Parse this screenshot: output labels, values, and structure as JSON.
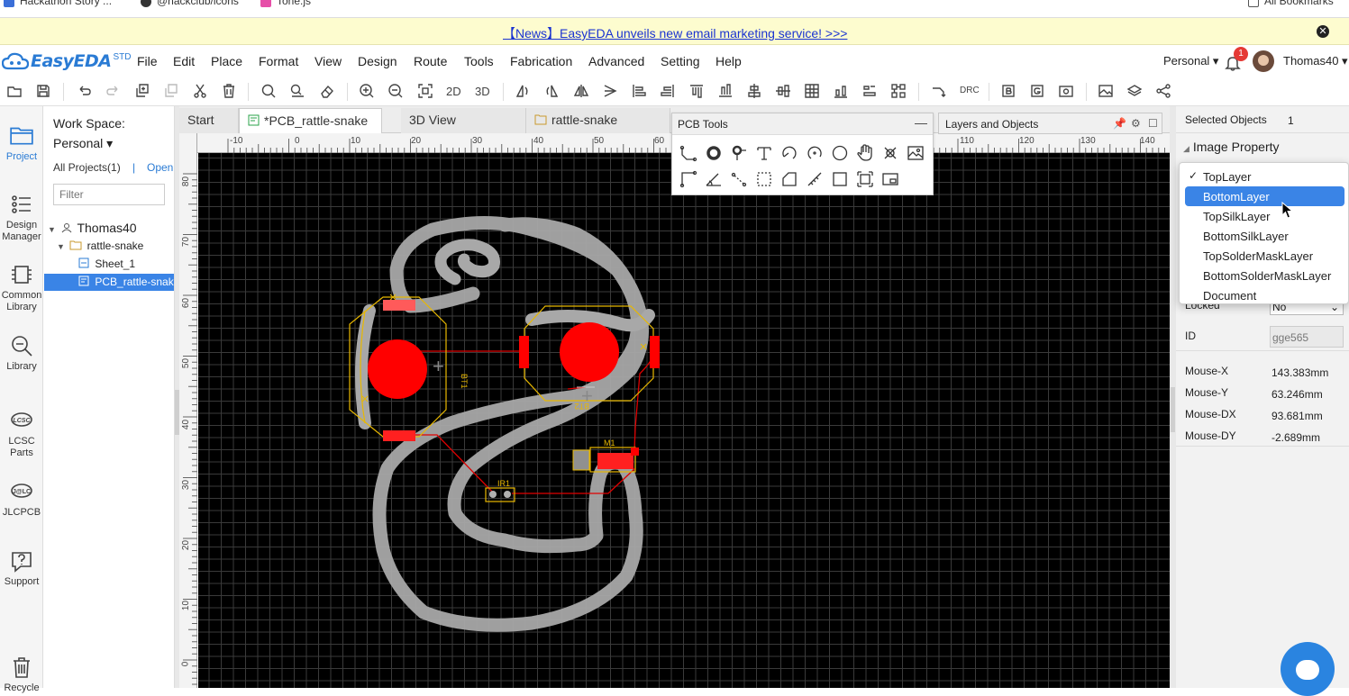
{
  "bookmarks": {
    "items": [
      "Hackathon Story ...",
      "@hackclub/icons",
      "Tone.js"
    ],
    "all": "All Bookmarks"
  },
  "news": {
    "text": "【News】EasyEDA unveils new email marketing service! >>>"
  },
  "logo": {
    "name": "EasyEDA",
    "edition": "STD"
  },
  "menu": [
    "File",
    "Edit",
    "Place",
    "Format",
    "View",
    "Design",
    "Route",
    "Tools",
    "Fabrication",
    "Advanced",
    "Setting",
    "Help"
  ],
  "user": {
    "workspace": "Personal",
    "notifications": "1",
    "name": "Thomas40"
  },
  "toolbar": {
    "view_2d": "2D",
    "view_3d": "3D",
    "drc": "DRC"
  },
  "leftnav": [
    {
      "label": "Project",
      "icon": "folder-icon"
    },
    {
      "label": "Design Manager",
      "icon": "list-icon"
    },
    {
      "label": "Common Library",
      "icon": "chip-icon"
    },
    {
      "label": "Library",
      "icon": "search-icon"
    },
    {
      "label": "LCSC Parts",
      "icon": "lcsc-icon"
    },
    {
      "label": "JLCPCB",
      "icon": "jlc-icon"
    },
    {
      "label": "Support",
      "icon": "help-icon"
    },
    {
      "label": "Recycle",
      "icon": "trash-icon"
    }
  ],
  "project_panel": {
    "workspace_label": "Work Space:",
    "workspace_value": "Personal",
    "all_projects": "All Projects(1)",
    "separator": "|",
    "open": "Open",
    "filter_placeholder": "Filter",
    "tree": {
      "user": "Thomas40",
      "project": "rattle-snake",
      "sheet": "Sheet_1",
      "pcb": "PCB_rattle-snake"
    }
  },
  "tabs": [
    "Start",
    "*PCB_rattle-snake",
    "3D View",
    "rattle-snake"
  ],
  "rulers": {
    "h": [
      "-10",
      "0",
      "10",
      "20",
      "30",
      "40",
      "50",
      "60",
      "110",
      "120",
      "130",
      "140"
    ],
    "v": [
      "80",
      "70",
      "60",
      "50",
      "40",
      "30",
      "20",
      "10",
      "0"
    ]
  },
  "pcb_labels": {
    "bt1": "BT1",
    "bt2": "BT2",
    "m1": "M1",
    "ir1": "IR1"
  },
  "pcb_tools": {
    "title": "PCB Tools"
  },
  "layers_panel": {
    "title": "Layers and Objects"
  },
  "right_panel": {
    "selected_label": "Selected Objects",
    "selected_count": "1",
    "image_property": "Image Property",
    "locked_label": "Locked",
    "locked_value": "No",
    "id_label": "ID",
    "id_value": "gge565",
    "mouse": [
      {
        "k": "Mouse-X",
        "v": "143.383mm"
      },
      {
        "k": "Mouse-Y",
        "v": "63.246mm"
      },
      {
        "k": "Mouse-DX",
        "v": "93.681mm"
      },
      {
        "k": "Mouse-DY",
        "v": "-2.689mm"
      }
    ]
  },
  "layer_dropdown": {
    "options": [
      "TopLayer",
      "BottomLayer",
      "TopSilkLayer",
      "BottomSilkLayer",
      "TopSolderMaskLayer",
      "BottomSolderMaskLayer",
      "Document"
    ],
    "checked": "TopLayer",
    "highlighted": "BottomLayer"
  },
  "colors": {
    "accent": "#2a7bd4",
    "selection": "#3a84e6",
    "copper": "#ff0000",
    "silk": "#ffcc00",
    "canvas": "#000000",
    "news_bg": "#fdfccf"
  }
}
